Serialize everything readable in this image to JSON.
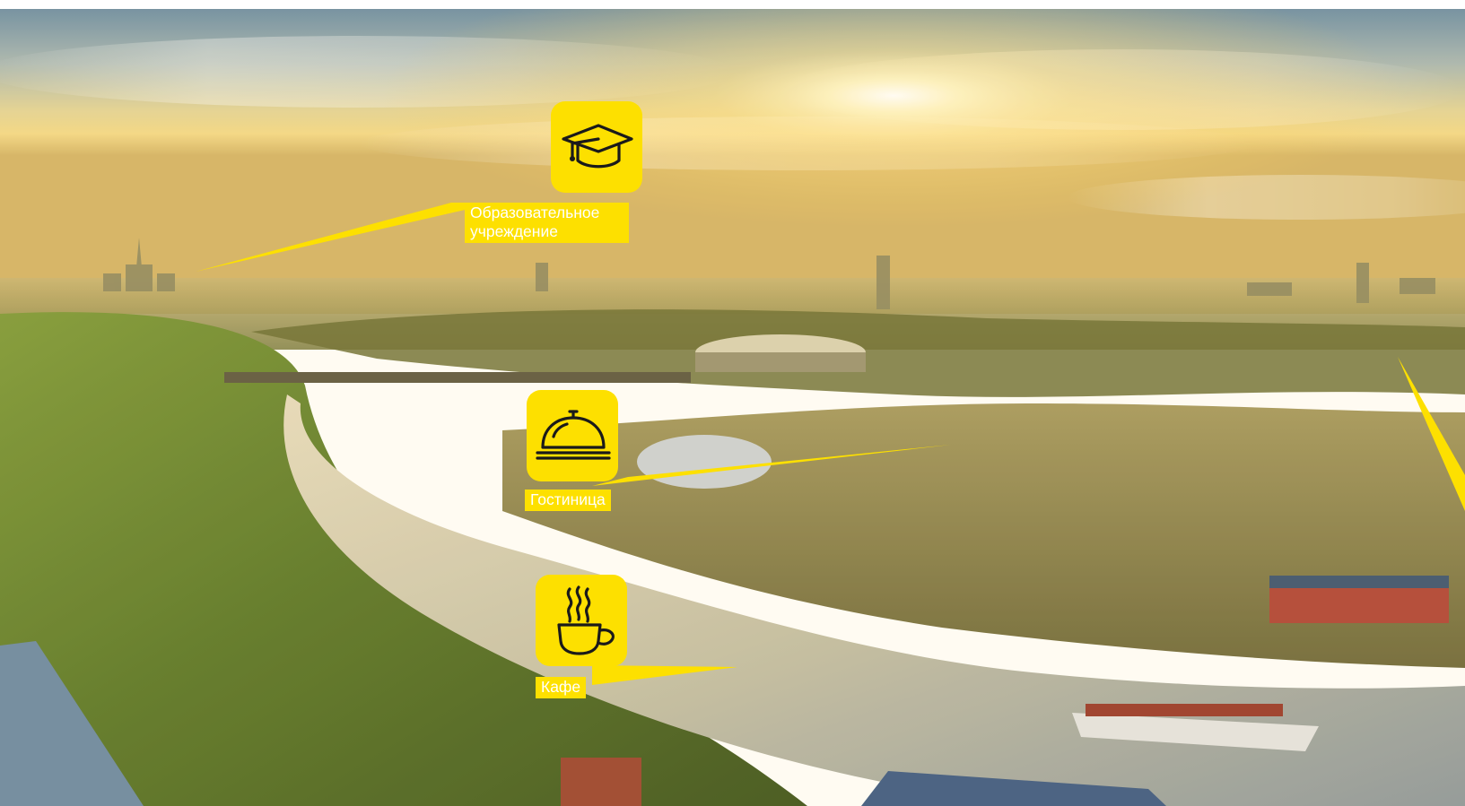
{
  "brand_color": "#fde000",
  "label_text_color": "#ffffff",
  "background": {
    "description_icon": "panorama-photo"
  },
  "pois": [
    {
      "id": "education",
      "icon": "graduation-cap-icon",
      "label": "Образовательное\nучреждение"
    },
    {
      "id": "hotel",
      "icon": "reception-bell-icon",
      "label": "Гостиница"
    },
    {
      "id": "cafe",
      "icon": "steaming-cup-icon",
      "label": "Кафе"
    }
  ]
}
